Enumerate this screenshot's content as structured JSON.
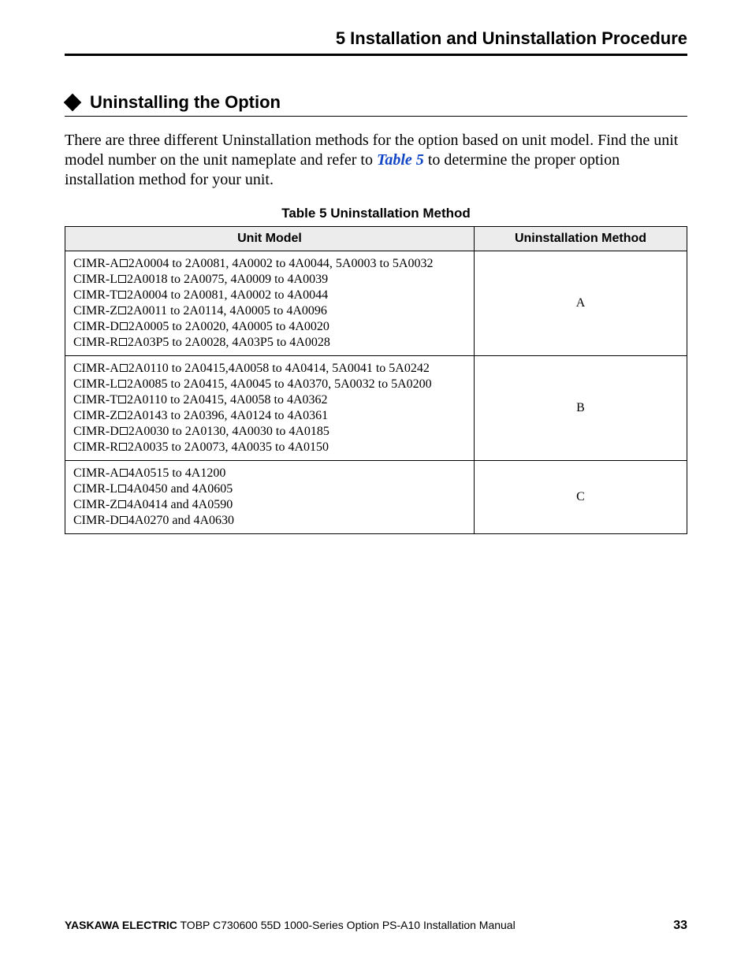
{
  "header": {
    "running_head": "5  Installation and Uninstallation Procedure"
  },
  "section": {
    "heading": "Uninstalling the Option",
    "intro_part1": "There are three different Uninstallation methods for the option based on unit model. Find the unit model number on the unit nameplate and refer to ",
    "table_ref": "Table 5",
    "intro_part2": " to determine the proper option installation method for your unit."
  },
  "table": {
    "caption": "Table 5  Uninstallation Method",
    "headers": {
      "model": "Unit Model",
      "method": "Uninstallation Method"
    },
    "rows": [
      {
        "lines": [
          {
            "prefix": "CIMR-A",
            "rest": "2A0004 to 2A0081, 4A0002 to 4A0044, 5A0003 to 5A0032"
          },
          {
            "prefix": "CIMR-L",
            "rest": "2A0018 to 2A0075, 4A0009 to 4A0039"
          },
          {
            "prefix": "CIMR-T",
            "rest": "2A0004 to 2A0081, 4A0002 to 4A0044"
          },
          {
            "prefix": "CIMR-Z",
            "rest": "2A0011 to 2A0114, 4A0005 to 4A0096"
          },
          {
            "prefix": "CIMR-D",
            "rest": "2A0005 to 2A0020, 4A0005 to 4A0020"
          },
          {
            "prefix": "CIMR-R",
            "rest": "2A03P5 to 2A0028, 4A03P5 to 4A0028"
          }
        ],
        "method": "A"
      },
      {
        "lines": [
          {
            "prefix": "CIMR-A",
            "rest": "2A0110 to 2A0415,4A0058 to 4A0414, 5A0041 to 5A0242"
          },
          {
            "prefix": "CIMR-L",
            "rest": "2A0085 to 2A0415, 4A0045 to 4A0370, 5A0032 to 5A0200"
          },
          {
            "prefix": "CIMR-T",
            "rest": "2A0110 to 2A0415, 4A0058 to 4A0362"
          },
          {
            "prefix": "CIMR-Z",
            "rest": "2A0143 to 2A0396, 4A0124 to 4A0361"
          },
          {
            "prefix": "CIMR-D",
            "rest": "2A0030 to 2A0130, 4A0030 to 4A0185"
          },
          {
            "prefix": "CIMR-R",
            "rest": "2A0035 to 2A0073, 4A0035 to 4A0150"
          }
        ],
        "method": "B"
      },
      {
        "lines": [
          {
            "prefix": "CIMR-A",
            "rest": "4A0515 to 4A1200"
          },
          {
            "prefix": "CIMR-L",
            "rest": "4A0450 and 4A0605"
          },
          {
            "prefix": "CIMR-Z",
            "rest": "4A0414 and 4A0590"
          },
          {
            "prefix": "CIMR-D",
            "rest": "4A0270 and 4A0630"
          }
        ],
        "method": "C"
      }
    ]
  },
  "footer": {
    "brand": "YASKAWA ELECTRIC",
    "doc": " TOBP C730600 55D 1000-Series Option PS-A10 Installation Manual",
    "page": "33"
  }
}
